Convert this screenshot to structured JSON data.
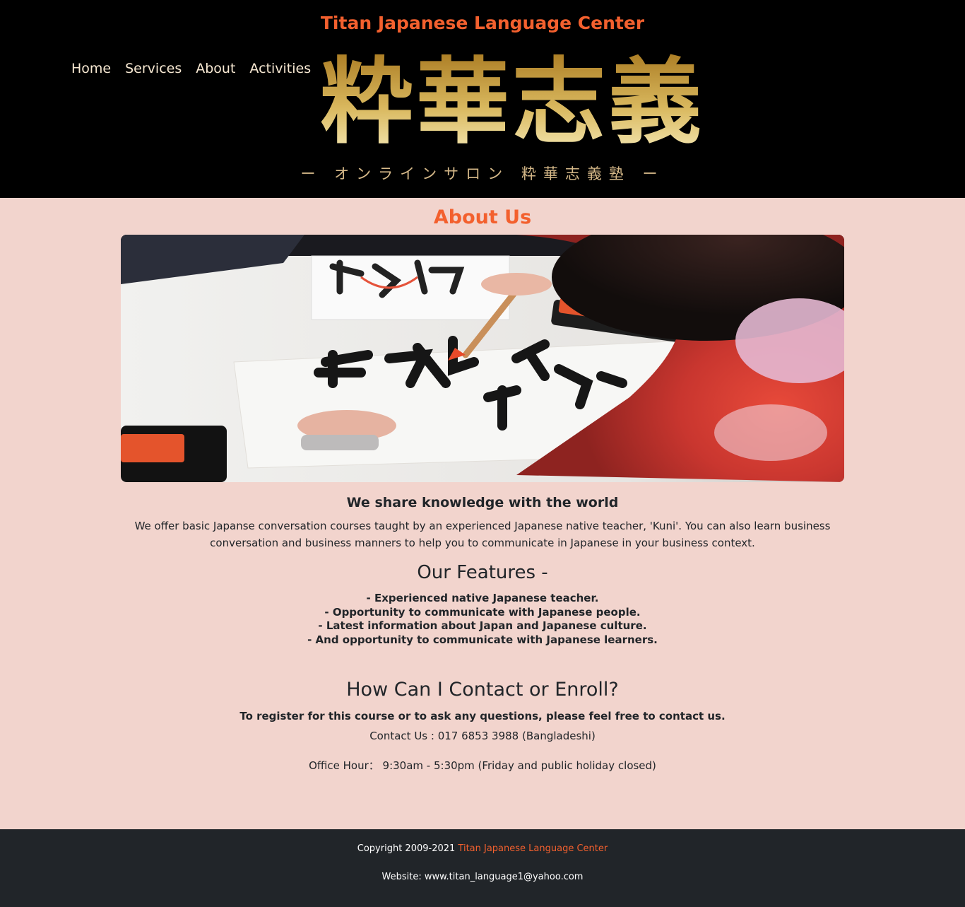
{
  "header": {
    "site_title": "Titan Japanese Language Center",
    "nav": [
      {
        "label": "Home"
      },
      {
        "label": "Services"
      },
      {
        "label": "About"
      },
      {
        "label": "Activities"
      }
    ],
    "logo_kanji": "粋華志義",
    "logo_subtitle": "ー オンラインサロン 粋華志義塾 ー"
  },
  "main": {
    "about_title": "About Us",
    "sub_heading": "We share knowledge with the world",
    "intro": "We offer basic Japanse conversation courses taught by an experienced Japanese native teacher, 'Kuni'. You can also learn business conversation and business manners to help you to communicate in Japanese in your business context.",
    "features_title": "Our Features -",
    "features": [
      "- Experienced native Japanese teacher.",
      "- Opportunity to communicate with Japanese people.",
      "- Latest information about Japan and Japanese culture.",
      "- And opportunity to communicate with Japanese learners."
    ],
    "contact_title": "How Can I Contact or Enroll?",
    "contact_note": "To register for this course or to ask any questions, please feel free to contact us.",
    "contact_phone": "Contact Us : 017 6853 3988 (Bangladeshi)",
    "office_hour": "Office Hour： 9:30am - 5:30pm (Friday and public holiday closed)"
  },
  "footer": {
    "copyright_prefix": "Copyright 2009-2021",
    "copyright_brand": "Titan Japanese Language Center",
    "website": "Website: www.titan_language1@yahoo.com"
  },
  "colors": {
    "accent": "#f3602e",
    "header_bg": "#000000",
    "page_bg": "#f2d4cd",
    "footer_bg": "#212529",
    "gold": "#d6b989"
  }
}
